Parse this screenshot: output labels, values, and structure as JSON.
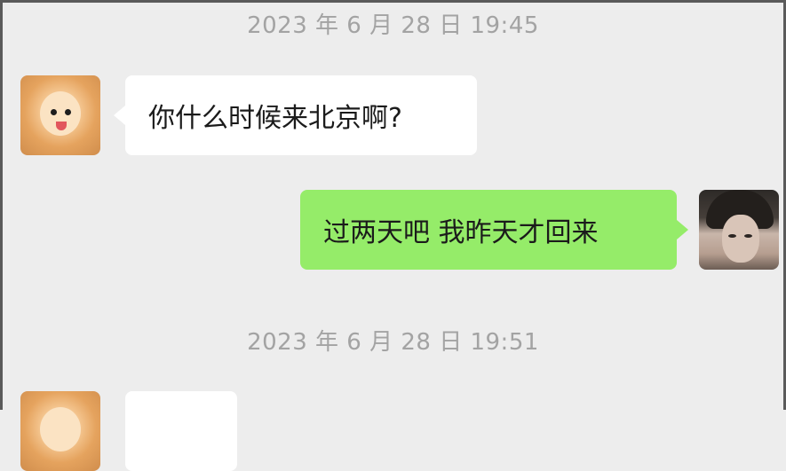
{
  "chat": {
    "messages": [
      {
        "timestamp": "2023 年 6 月 28 日 19:45",
        "sender": "other",
        "text": "你什么时候来北京啊?"
      },
      {
        "sender": "me",
        "text": "过两天吧 我昨天才回来"
      },
      {
        "timestamp": "2023 年 6 月 28 日 19:51",
        "sender": "other",
        "text": ""
      }
    ]
  },
  "theme": {
    "background": "#ededed",
    "bubble_incoming": "#ffffff",
    "bubble_outgoing": "#95ec69",
    "timestamp_color": "#a3a3a3"
  }
}
